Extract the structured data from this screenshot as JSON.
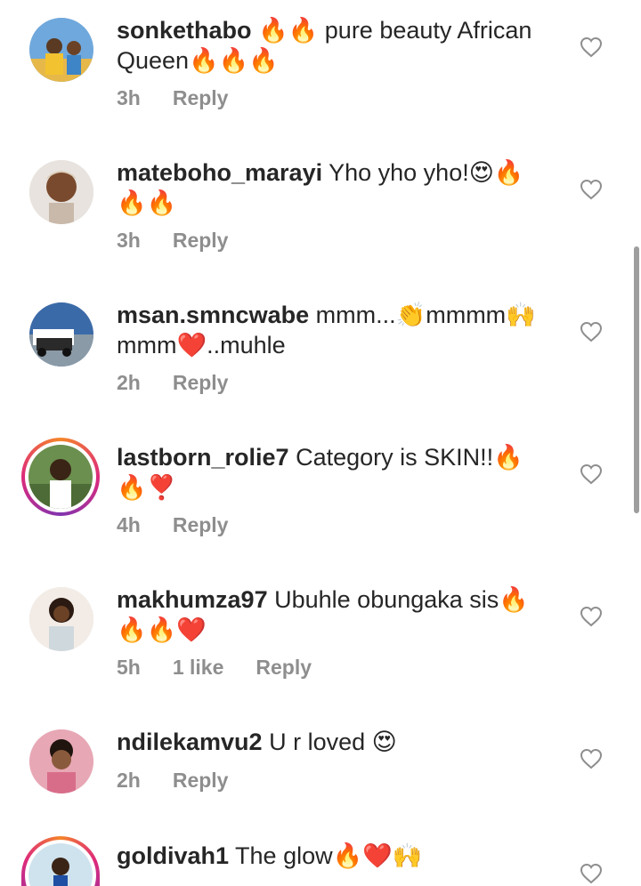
{
  "comments": [
    {
      "username": "sonkethabo",
      "text": "🔥🔥 pure beauty African Queen🔥🔥🔥",
      "time": "3h",
      "reply_label": "Reply",
      "likes": ""
    },
    {
      "username": "mateboho_marayi",
      "text": "Yho yho yho!😍🔥🔥🔥",
      "time": "3h",
      "reply_label": "Reply",
      "likes": ""
    },
    {
      "username": "msan.smncwabe",
      "text": "mmm...👏mmmm🙌 mmm❤️..muhle",
      "time": "2h",
      "reply_label": "Reply",
      "likes": ""
    },
    {
      "username": "lastborn_rolie7",
      "text": "Category is SKIN!!🔥🔥❣️",
      "time": "4h",
      "reply_label": "Reply",
      "likes": ""
    },
    {
      "username": "makhumza97",
      "text": "Ubuhle obungaka sis🔥🔥🔥❤️",
      "time": "5h",
      "reply_label": "Reply",
      "likes": "1 like"
    },
    {
      "username": "ndilekamvu2",
      "text": "U r loved 😍",
      "time": "2h",
      "reply_label": "Reply",
      "likes": ""
    },
    {
      "username": "goldivah1",
      "text": "The glow🔥❤️🙌",
      "time": "",
      "reply_label": "",
      "likes": ""
    }
  ],
  "icons": {
    "like": "heart-outline-icon"
  },
  "colors": {
    "text": "#262626",
    "meta": "#8e8e8e",
    "heart": "#8e8e8e"
  }
}
